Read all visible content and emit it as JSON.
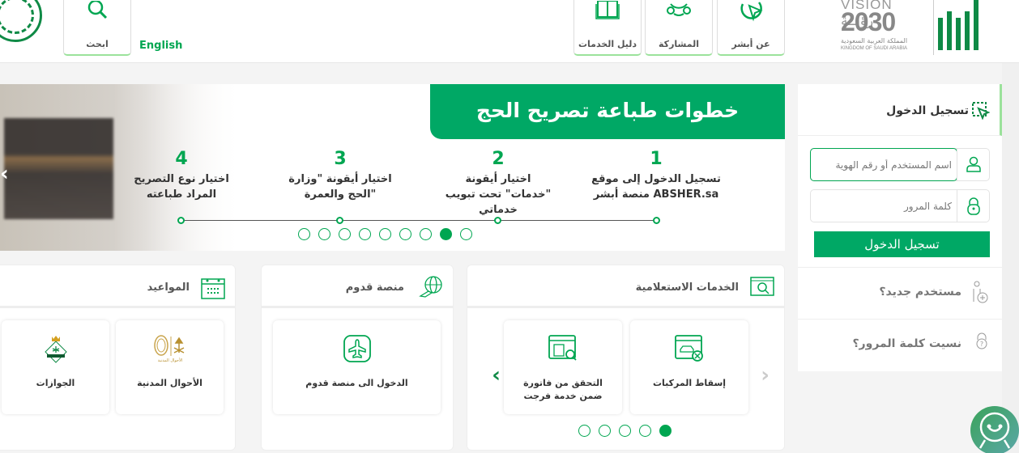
{
  "header": {
    "nav": [
      {
        "label": "عن أبشر",
        "icon": "cursor-circle-icon"
      },
      {
        "label": "المشاركة",
        "icon": "share-network-icon"
      },
      {
        "label": "دليل الخدمات",
        "icon": "book-icon"
      }
    ],
    "search": {
      "label": "ابحث",
      "icon": "search-icon"
    },
    "language_link": "English",
    "vision": {
      "line1": "VISION رؤيــة",
      "line2": "2030",
      "line3": "المملكة العربية السعودية",
      "line4": "KINGDOM OF SAUDI ARABIA"
    }
  },
  "banner": {
    "title": "خطوات طباعة تصريح الحج",
    "steps": [
      {
        "num": "1",
        "text": "تسجيل الدخول إلى موقع منصة أبشر ABSHER.sa"
      },
      {
        "num": "2",
        "text": "اختيار أيقونة \"خدمات\" تحت تبويب خدماتي"
      },
      {
        "num": "3",
        "text": "اختيار أيقونة \"وزارة الحج والعمرة\""
      },
      {
        "num": "4",
        "text": "اختيار نوع التصريح المراد طباعته"
      }
    ],
    "slide_count": 9,
    "active_slide_from_right": 2
  },
  "login": {
    "title": "تسجيل الدخول",
    "username_placeholder": "اسم المستخدم أو رقم الهوية",
    "password_placeholder": "كلمة المرور",
    "submit": "تسجيل الدخول",
    "new_user": "مستخدم جديد؟",
    "forgot_password": "نسيت كلمة المرور؟"
  },
  "panels": {
    "inquiry": {
      "title": "الخدمات الاستعلامية",
      "cards": [
        {
          "label": "إسقاط المركبات"
        },
        {
          "label": "التحقق من فاتورة ضمن خدمة فرجت"
        }
      ],
      "dot_count": 5,
      "active_dot_from_right": 1
    },
    "qudoom": {
      "title": "منصة قدوم",
      "cards": [
        {
          "label": "الدخول الى منصة قدوم"
        }
      ]
    },
    "appointments": {
      "title": "المواعيد",
      "cards": [
        {
          "label": "الأحوال المدنية",
          "logo_caption": "الأحوال المدنية"
        },
        {
          "label": "الجوازات"
        }
      ]
    }
  },
  "colors": {
    "primary": "#00a865",
    "accent_border": "#9be29b",
    "text": "#333333"
  }
}
